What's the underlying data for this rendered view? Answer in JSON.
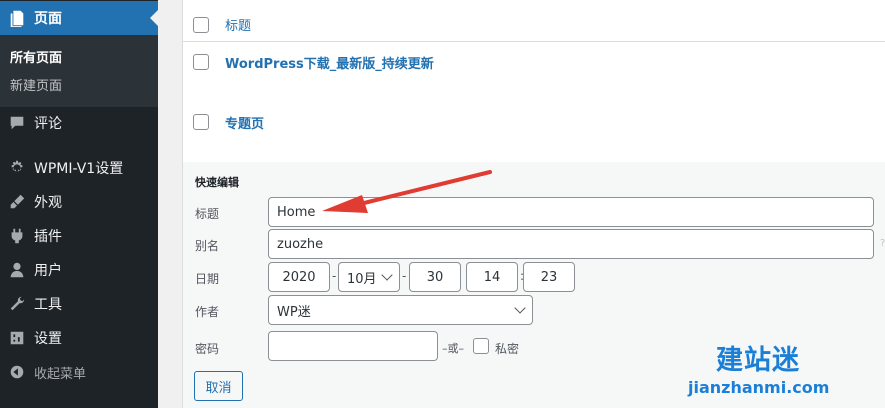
{
  "sidebar": {
    "pages": {
      "label": "页面",
      "icon": "pages-icon"
    },
    "submenu": {
      "all_pages": "所有页面",
      "new_page": "新建页面"
    },
    "items": [
      {
        "label": "评论",
        "icon": "comment-icon"
      },
      {
        "label": "WPMI-V1设置",
        "icon": "gear-icon"
      },
      {
        "label": "外观",
        "icon": "brush-icon"
      },
      {
        "label": "插件",
        "icon": "plug-icon"
      },
      {
        "label": "用户",
        "icon": "user-icon"
      },
      {
        "label": "工具",
        "icon": "wrench-icon"
      },
      {
        "label": "设置",
        "icon": "settings-icon"
      }
    ],
    "collapse": {
      "label": "收起菜单",
      "icon": "collapse-icon"
    }
  },
  "list": {
    "header_title": "标题",
    "rows": [
      {
        "title": "WordPress下载_最新版_持续更新"
      },
      {
        "title": "专题页"
      }
    ]
  },
  "quick_edit": {
    "heading": "快速编辑",
    "title_label": "标题",
    "title_value": "Home",
    "slug_label": "别名",
    "slug_value": "zuozhe",
    "date_label": "日期",
    "date": {
      "year": "2020",
      "month": "10月",
      "day": "30",
      "hour": "14",
      "minute": "23"
    },
    "author_label": "作者",
    "author_value": "WP迷",
    "password_label": "密码",
    "or_text": "–或–",
    "private_label": "私密",
    "cancel": "取消"
  },
  "watermark": {
    "cn": "建站迷",
    "en": "jianzhanmi.com"
  },
  "colors": {
    "sidebar_bg": "#1d2327",
    "accent": "#2271b1",
    "arrow": "#e03c31",
    "watermark": "#1a7fd6"
  }
}
